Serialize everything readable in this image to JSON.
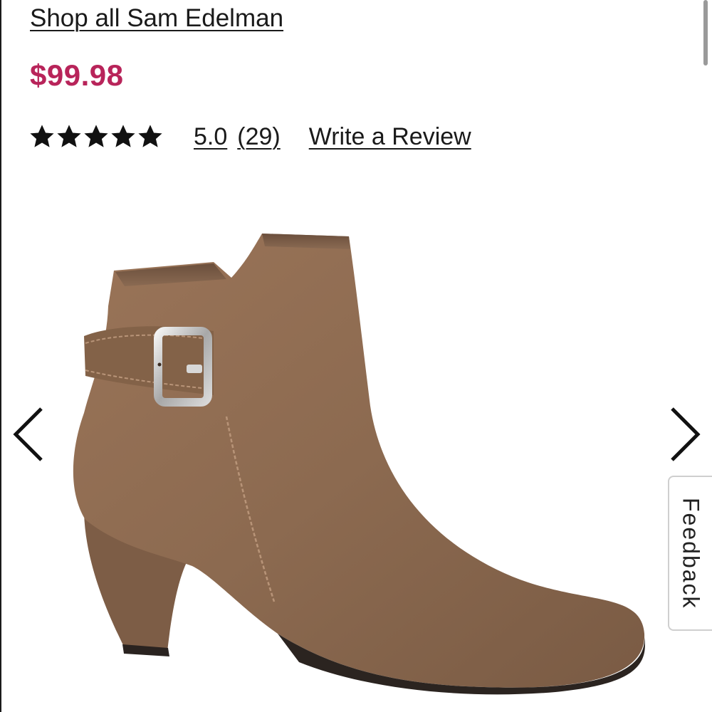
{
  "product": {
    "brand_link": "Shop all Sam Edelman",
    "price": "$99.98",
    "price_color": "#b8245a",
    "rating": {
      "stars": 5,
      "max_stars": 5,
      "value": "5.0",
      "count": "(29)",
      "write_review_label": "Write a Review"
    }
  },
  "gallery": {
    "image_alt": "brown suede ankle boot with buckle strap",
    "prev_icon": "chevron-left-icon",
    "next_icon": "chevron-right-icon"
  },
  "feedback_tab": {
    "label": "Feedback"
  }
}
